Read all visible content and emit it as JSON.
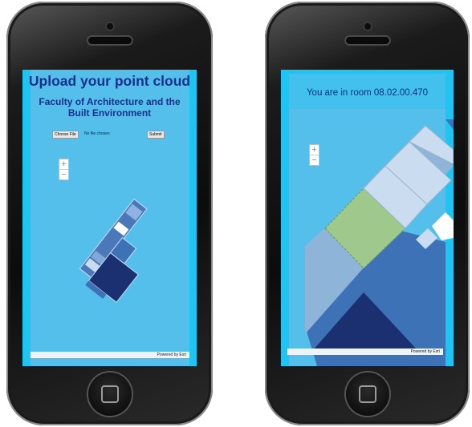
{
  "screen1": {
    "title": "Upload your point cloud",
    "subtitle": "Faculty of Architecture and the Built Environment",
    "choose_file": "Choose File",
    "file_status": "No file chosen",
    "submit": "Submit",
    "zoom_in": "+",
    "zoom_out": "−",
    "attribution": "Powered by Esri"
  },
  "screen2": {
    "room_text": "You are in room 08.02.00.470",
    "zoom_in": "+",
    "zoom_out": "−",
    "attribution": "Powered by Esri"
  },
  "colors": {
    "screen_bg": "#1ec4f2",
    "map_bg": "#55bfec",
    "title_color": "#1a2f8c",
    "dark_room": "#1a3070",
    "mid_blue": "#3e72b6",
    "light_blue": "#c9dcf0",
    "current_room": "#9ec88c"
  }
}
